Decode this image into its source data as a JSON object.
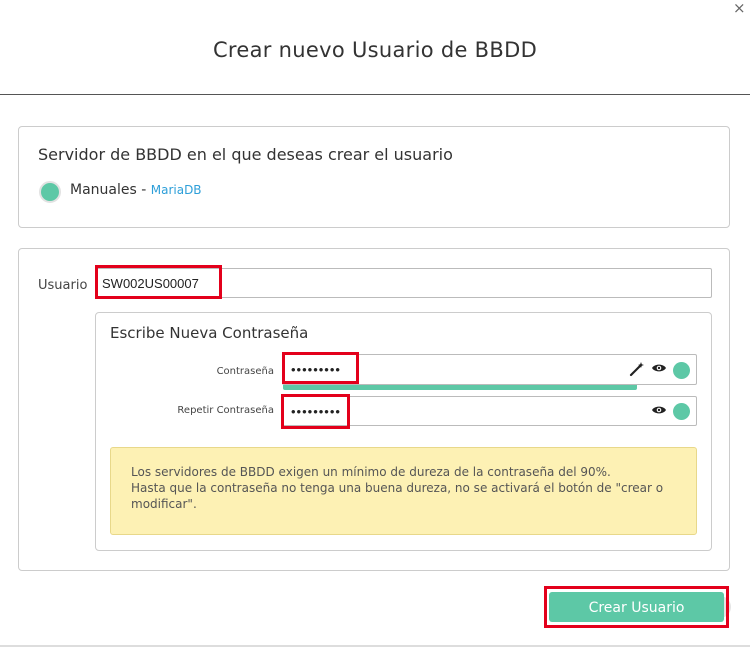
{
  "dialog": {
    "title": "Crear nuevo Usuario de BBDD",
    "close_glyph": "×"
  },
  "server_section": {
    "label": "Servidor de BBDD en el que deseas crear el usuario",
    "option": {
      "name": "Manuales",
      "separator": " - ",
      "engine": "MariaDB",
      "selected": true
    }
  },
  "user_section": {
    "label": "Usuario",
    "value": "SW002US00007"
  },
  "password_section": {
    "title": "Escribe Nueva Contraseña",
    "password_label": "Contraseña",
    "password_value": "•••••••••",
    "repeat_label": "Repetir Contraseña",
    "repeat_value": "•••••••••",
    "strength_percent": 100
  },
  "notice": {
    "line1": "Los servidores de BBDD exigen un mínimo de dureza de la contraseña del 90%.",
    "line2": "Hasta que la contraseña no tenga una buena dureza, no se activará el botón de \"crear o modificar\"."
  },
  "actions": {
    "submit_label": "Crear Usuario"
  },
  "colors": {
    "accent": "#5dc8a6",
    "highlight": "#e3001b",
    "notice_bg": "#fdf1b4",
    "link": "#2e9fd9"
  },
  "icons": {
    "generate": "magic-wand-icon",
    "reveal": "eye-icon",
    "status": "status-dot-icon"
  }
}
